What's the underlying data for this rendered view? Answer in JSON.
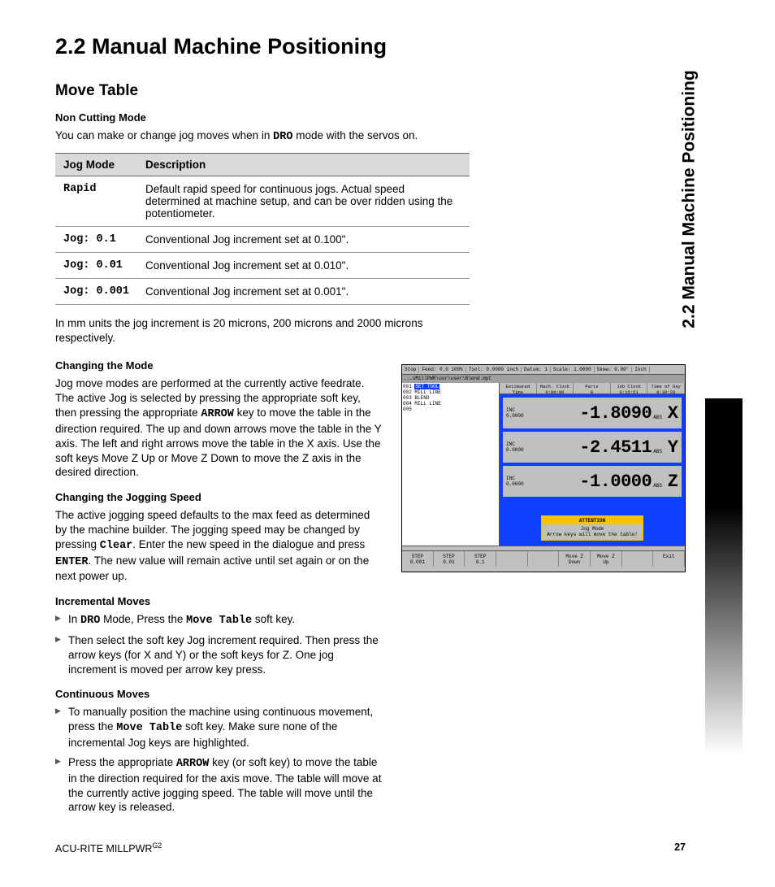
{
  "sideTab": "2.2 Manual Machine Positioning",
  "title": "2.2  Manual Machine Positioning",
  "moveTable": {
    "heading": "Move Table",
    "nonCuttingHeading": "Non Cutting Mode",
    "intro_a": "You can make or change jog moves when in ",
    "intro_dro": "DRO",
    "intro_b": " mode with the servos on.",
    "tableHeaders": {
      "mode": "Jog Mode",
      "desc": "Description"
    },
    "rows": [
      {
        "mode": "Rapid",
        "desc": "Default rapid speed for continuous jogs. Actual speed determined at machine setup, and can be over ridden using the potentiometer."
      },
      {
        "mode": "Jog: 0.1",
        "desc": "Conventional Jog increment set at 0.100\"."
      },
      {
        "mode": "Jog: 0.01",
        "desc": "Conventional Jog increment set at 0.010\"."
      },
      {
        "mode": "Jog: 0.001",
        "desc": "Conventional Jog increment set at 0.001\"."
      }
    ],
    "unitsNote": "In mm units the jog increment is 20 microns, 200 microns and 2000 microns respectively."
  },
  "changingMode": {
    "heading": "Changing the Mode",
    "p_a": "Jog move modes are performed at the currently active feedrate. The active Jog is selected by pressing the appropriate soft key, then pressing the appropriate ",
    "p_arrow": "ARROW",
    "p_b": " key to move the table in the direction required. The up and down arrows move the table in the Y axis. The left and right arrows move the table in the X axis. Use the soft keys Move Z Up or Move Z Down to move the Z axis in the desired direction."
  },
  "changingSpeed": {
    "heading": "Changing the Jogging Speed",
    "p_a": "The active jogging speed defaults to the max feed as determined by the machine builder. The jogging speed may be changed by pressing ",
    "p_clear": "Clear",
    "p_b": ". Enter the new speed in the dialogue and press ",
    "p_enter": "ENTER",
    "p_c": ".  The new value will remain active until set again or on the next power up."
  },
  "incremental": {
    "heading": "Incremental Moves",
    "i1_a": "In ",
    "i1_dro": "DRO",
    "i1_b": " Mode, Press the ",
    "i1_mt": "Move Table",
    "i1_c": " soft key.",
    "i2": "Then select the soft key Jog increment required. Then press the arrow keys (for X and Y) or the soft keys for Z. One jog increment is moved per arrow key press."
  },
  "continuous": {
    "heading": "Continuous Moves",
    "c1_a": "To manually position the machine using continuous movement, press the ",
    "c1_mt": "Move Table",
    "c1_b": " soft key. Make sure none of the incremental Jog keys are highlighted.",
    "c2_a": "Press the appropriate ",
    "c2_arrow": "ARROW",
    "c2_b": " key (or soft key) to move the table in the direction required for the axis move. The table will move at the currently active jogging speed. The table will move until the arrow key is released."
  },
  "screenshot": {
    "topbar": {
      "stop": "Stop",
      "feed": "Feed:   0.0 100%",
      "tool": "Tool: 0.0000 inch",
      "datum": "Datum: 1",
      "scale": "Scale: 1.0000",
      "skew": "Skew: 0.00°",
      "unit": "Inch"
    },
    "path": "...sMillPWR\\usr\\user\\Blend.mpt",
    "program": [
      {
        "n": "001",
        "step": "SET TOOL",
        "hl": true
      },
      {
        "n": "002",
        "step": "MILL LINE"
      },
      {
        "n": "003",
        "step": "BLEND"
      },
      {
        "n": "004",
        "step": "MILL LINE"
      },
      {
        "n": "005",
        "step": ""
      }
    ],
    "timebar": [
      {
        "l1": "Estimated Time",
        "l2": "0:00:00"
      },
      {
        "l1": "Mach. Clock",
        "l2": "0:00:00"
      },
      {
        "l1": "Parts",
        "l2": "0"
      },
      {
        "l1": "Job Clock",
        "l2": "0:15:51"
      },
      {
        "l1": "Time of Day",
        "l2": "8:30:28"
      }
    ],
    "dro": [
      {
        "inc1": "INC",
        "inc2": "0.0000",
        "val": "-1.8090",
        "abs": "ABS",
        "ax": "X"
      },
      {
        "inc1": "INC",
        "inc2": "0.0000",
        "val": "-2.4511",
        "abs": "ABS",
        "ax": "Y"
      },
      {
        "inc1": "INC",
        "inc2": "0.0000",
        "val": "-1.0000",
        "abs": "ABS",
        "ax": "Z"
      }
    ],
    "attention": {
      "title": "ATTENTION",
      "line1": "Jog Mode",
      "line2": "Arrow keys will move the table!"
    },
    "softkeys": [
      {
        "l1": "STEP",
        "l2": "0.001"
      },
      {
        "l1": "STEP",
        "l2": "0.01"
      },
      {
        "l1": "STEP",
        "l2": "0.1"
      },
      {
        "l1": "",
        "l2": ""
      },
      {
        "l1": "",
        "l2": ""
      },
      {
        "l1": "Move Z",
        "l2": "Down"
      },
      {
        "l1": "Move Z",
        "l2": "Up"
      },
      {
        "l1": "",
        "l2": ""
      },
      {
        "l1": "Exit",
        "l2": ""
      }
    ]
  },
  "footer": {
    "left_a": "ACU-RITE MILLPWR",
    "left_sup": "G2",
    "page": "27"
  }
}
